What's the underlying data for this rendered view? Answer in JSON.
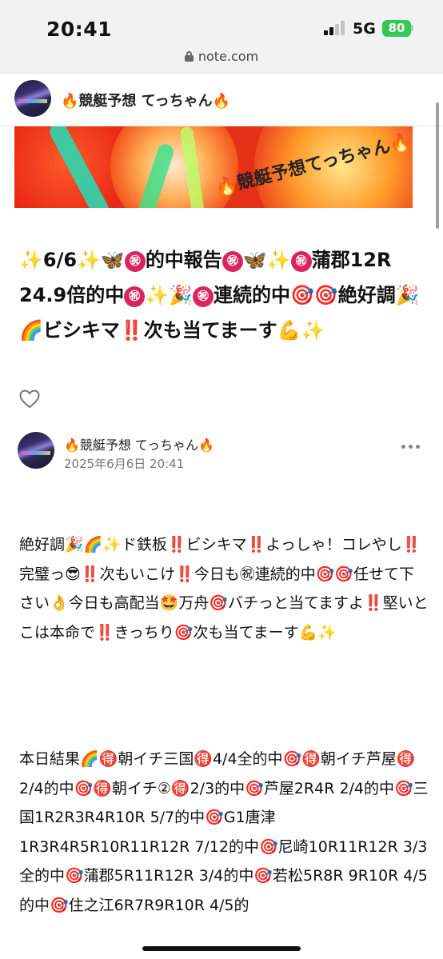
{
  "status_bar": {
    "time": "20:41",
    "network": "5G",
    "battery": "80"
  },
  "url_bar": {
    "domain": "note.com"
  },
  "creator": {
    "name": "🔥競艇予想 てっちゃん🔥"
  },
  "banner": {
    "text": "🔥競艇予想てっちゃん🔥"
  },
  "article": {
    "title_parts": [
      "✨6/6✨🦋",
      "㊗",
      "的中報告",
      "㊗",
      "🦋✨",
      "㊗",
      "蒲郡12R 24.9倍的中",
      "㊗",
      "✨🎉",
      "㊗",
      "連続的中🎯🎯絶好調🎉🌈ビシキマ‼️次も当てまーす💪✨"
    ],
    "author": "🔥競艇予想 てっちゃん🔥",
    "date": "2025年6月6日 20:41",
    "paragraph1": "絶好調🎉🌈✨ド鉄板‼️ビシキマ‼️よっしゃ！コレやし‼️完璧っ😎‼️次もいこけ‼️今日も㊗連続的中🎯🎯任せて下さい👌今日も高配当🤩万舟🎯バチっと当てますよ‼️堅いとこは本命で‼️きっちり🎯次も当てまーす💪✨",
    "paragraph2": "本日結果🌈🉐朝イチ三国🉐4/4全的中🎯🉐朝イチ芦屋🉐2/4的中🎯🉐朝イチ②🉐2/3的中🎯芦屋2R4R 2/4的中🎯三国1R2R3R4R10R 5/7的中🎯G1唐津1R3R4R5R10R11R12R 7/12的中🎯尼崎10R11R12R 3/3全的中🎯蒲郡5R11R12R 3/4的中🎯若松5R8R 9R10R 4/5的中🎯住之江6R7R9R10R 4/5的"
  },
  "colors": {
    "status_bg": "#f2f2f2",
    "battery_green": "#34c759",
    "badge_red": "#d9245f",
    "banner_red": "#e53018"
  },
  "icons": [
    "lock-icon",
    "heart-icon",
    "more-icon",
    "signal-icon",
    "battery-icon"
  ]
}
